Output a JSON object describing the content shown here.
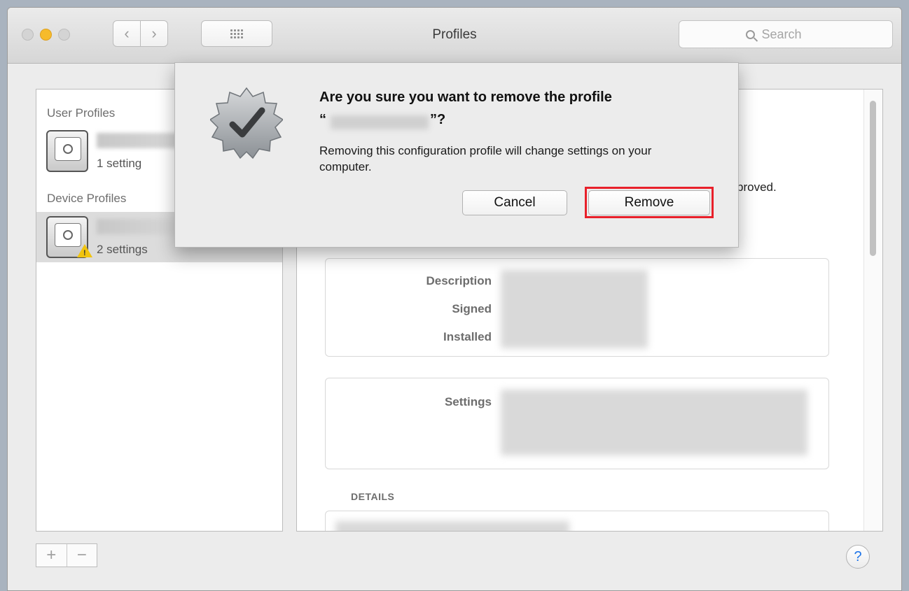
{
  "window": {
    "title": "Profiles",
    "search": {
      "placeholder": "Search"
    }
  },
  "sidebar": {
    "user_profiles_header": "User Profiles",
    "device_profiles_header": "Device Profiles",
    "user_profiles": [
      {
        "settings": "1 setting"
      }
    ],
    "device_profiles": [
      {
        "settings": "2 settings"
      }
    ],
    "add_label": "+",
    "remove_label": "−"
  },
  "detail": {
    "approved_fragment": "proved.",
    "labels": {
      "description": "Description",
      "signed": "Signed",
      "installed": "Installed",
      "settings": "Settings"
    },
    "details_heading": "DETAILS"
  },
  "dialog": {
    "title": "Are you sure you want to remove the profile",
    "quote_open": "“",
    "quote_close": "”?",
    "message": "Removing this configuration profile will change settings on your computer.",
    "cancel_label": "Cancel",
    "remove_label": "Remove"
  },
  "help_label": "?",
  "colors": {
    "highlight": "#e8202a",
    "minimize": "#f6bb2b",
    "help_accent": "#1f75e8"
  }
}
